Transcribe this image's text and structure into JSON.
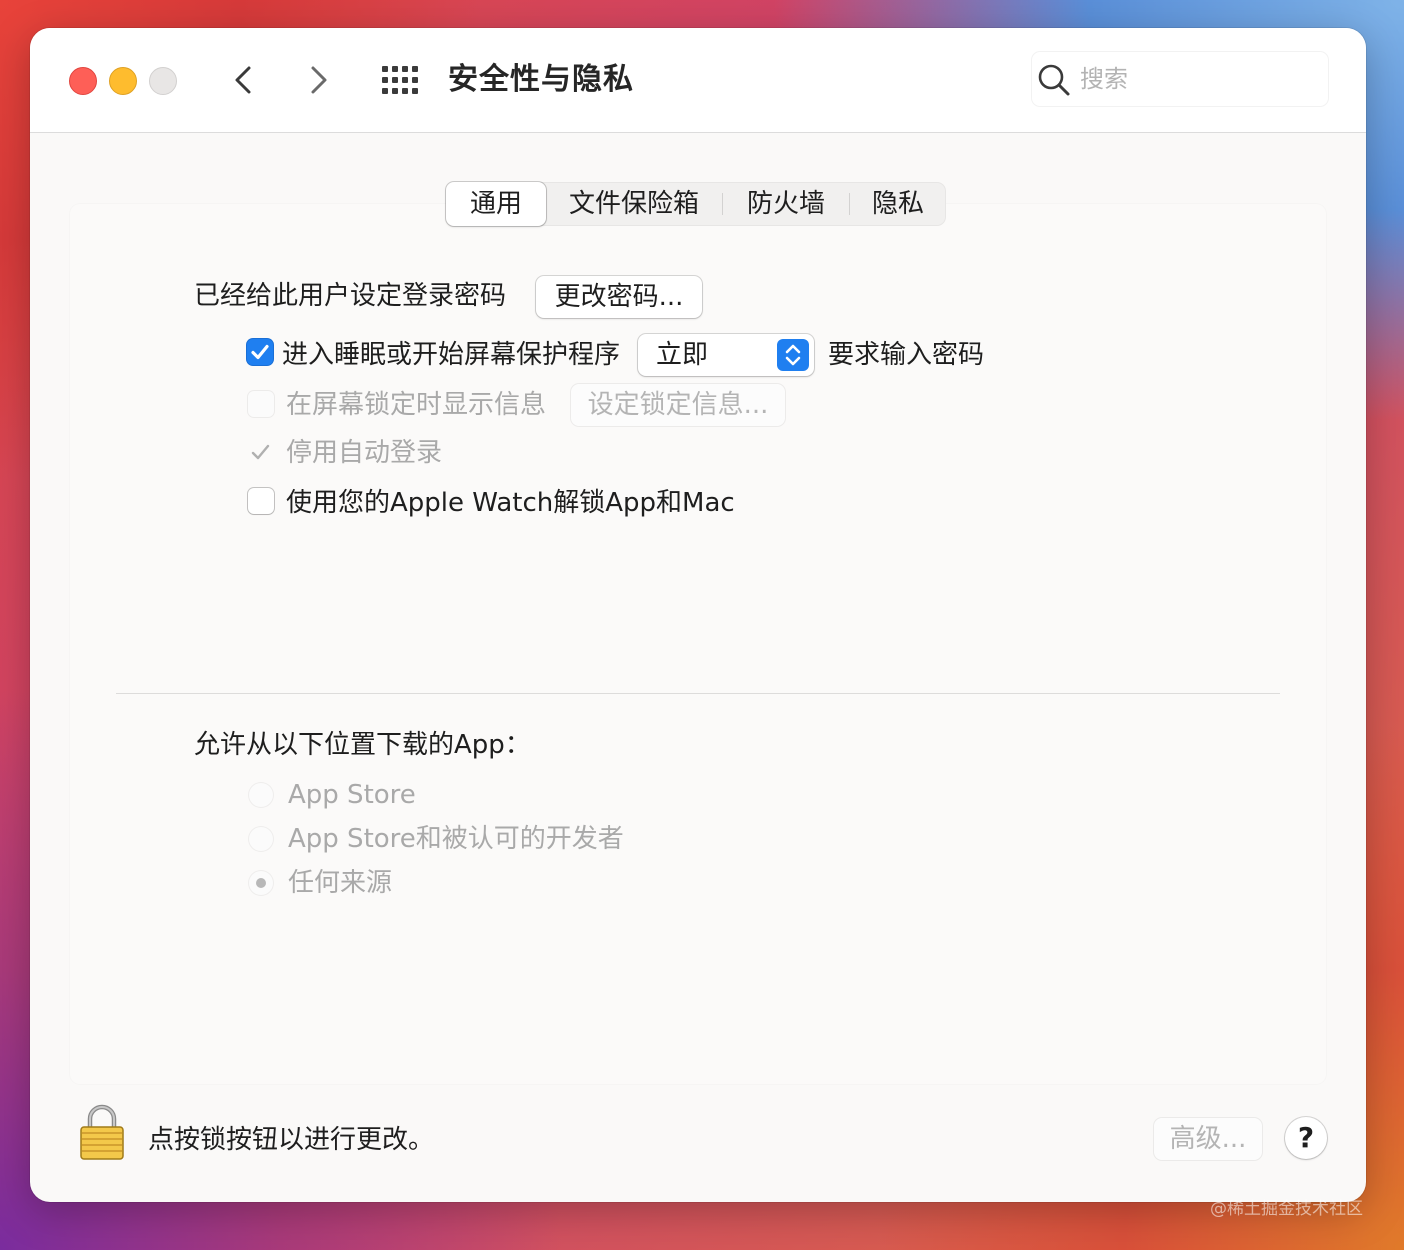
{
  "window": {
    "title": "安全性与隐私",
    "search_placeholder": "搜索"
  },
  "tabs": [
    {
      "label": "通用",
      "active": true
    },
    {
      "label": "文件保险箱",
      "active": false
    },
    {
      "label": "防火墙",
      "active": false
    },
    {
      "label": "隐私",
      "active": false
    }
  ],
  "general": {
    "password_set_label": "已经给此用户设定登录密码",
    "change_password_button": "更改密码...",
    "require_password": {
      "checked": true,
      "prefix": "进入睡眠或开始屏幕保护程序",
      "delay_value": "立即",
      "suffix": "要求输入密码"
    },
    "show_message": {
      "checked": false,
      "enabled": false,
      "label": "在屏幕锁定时显示信息",
      "button": "设定锁定信息..."
    },
    "disable_auto_login": {
      "checked": true,
      "enabled": false,
      "label": "停用自动登录"
    },
    "apple_watch_unlock": {
      "checked": false,
      "label": "使用您的Apple Watch解锁App和Mac"
    }
  },
  "downloads": {
    "heading": "允许从以下位置下载的App：",
    "options": [
      {
        "label": "App Store",
        "selected": false
      },
      {
        "label": "App Store和被认可的开发者",
        "selected": false
      },
      {
        "label": "任何来源",
        "selected": true
      }
    ]
  },
  "footer": {
    "lock_text": "点按锁按钮以进行更改。",
    "advanced_button": "高级...",
    "help_button": "?"
  },
  "watermark": "@稀土掘金技术社区",
  "colors": {
    "accent": "#1f7ff0",
    "traffic_red": "#fe5f57",
    "traffic_yellow": "#febc2e",
    "traffic_gray": "#e8e6e5"
  }
}
